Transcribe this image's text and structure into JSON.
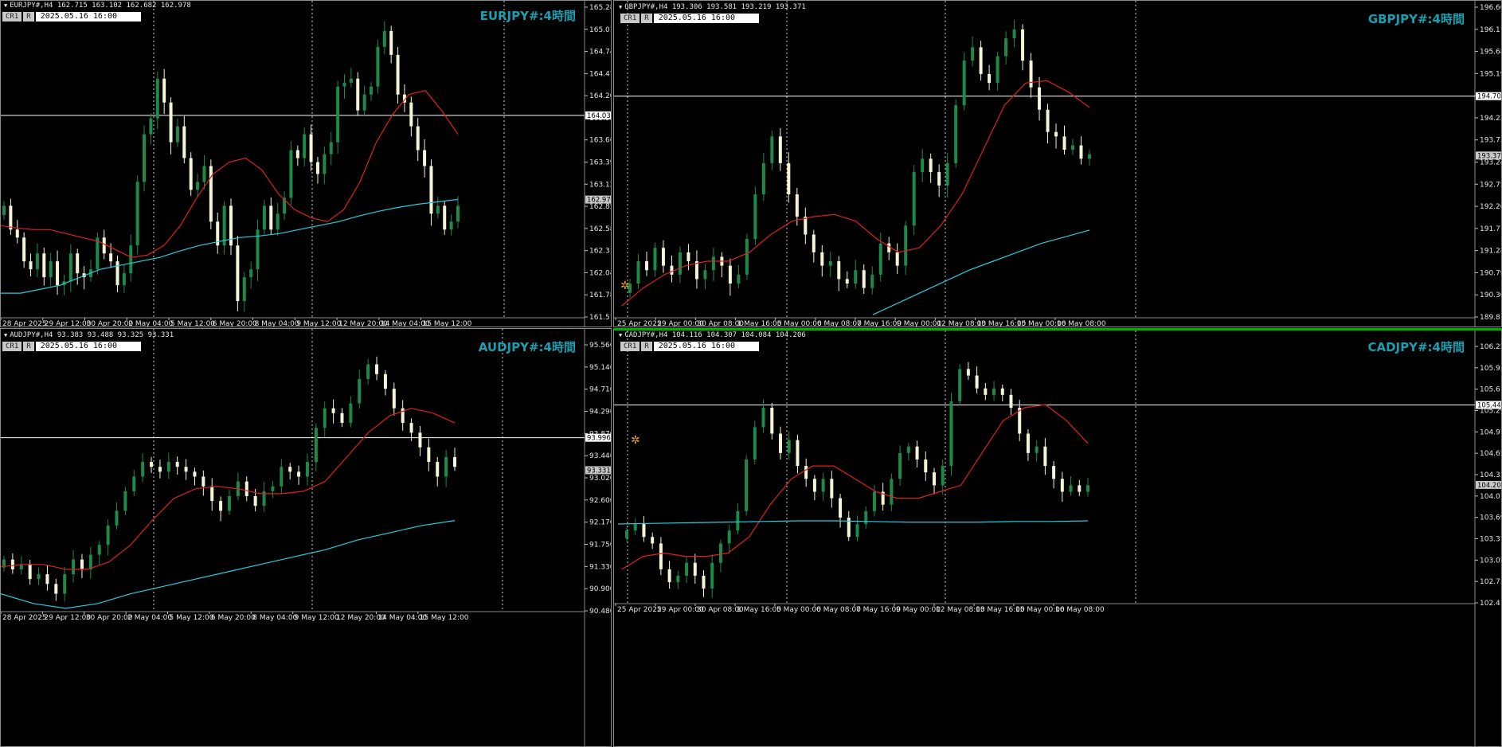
{
  "colors": {
    "bull": "#1e8a4a",
    "bear": "#f5f5d6",
    "ma_fast": "#e02020",
    "ma_slow": "#22cfe0",
    "title": "#1a9fb0",
    "hline": "#ffffff"
  },
  "chart_data": [
    {
      "type": "candlestick",
      "title": "EURJPY#:4時間",
      "header": "EURJPY#,H4  162.715 163.102 162.682 162.978",
      "chip_label": "CR1",
      "chip_r": "R",
      "datetime": "2025.05.16 16:00",
      "ylim": [
        161.5,
        165.4
      ],
      "yticks": [
        "165.280",
        "165.010",
        "164.740",
        "164.470",
        "164.200",
        "163.930",
        "163.665",
        "163.395",
        "163.125",
        "162.855",
        "162.585",
        "162.315",
        "162.045",
        "161.780",
        "161.510"
      ],
      "xticks": [
        "28 Apr 2025",
        "29 Apr 12:00",
        "30 Apr 20:00",
        "2 May 04:00",
        "5 May 12:00",
        "6 May 20:00",
        "8 May 04:00",
        "9 May 12:00",
        "12 May 20:00",
        "14 May 04:00",
        "15 May 12:00"
      ],
      "hline": {
        "value": 164.038,
        "label": "164.038"
      },
      "current": {
        "value": 162.978,
        "label": "162.978"
      },
      "closes": [
        162.9,
        162.6,
        162.5,
        162.2,
        162.1,
        162.3,
        162.0,
        162.2,
        161.9,
        161.95,
        162.3,
        162.05,
        162.0,
        162.1,
        162.5,
        162.3,
        162.2,
        161.9,
        162.05,
        162.4,
        163.2,
        163.8,
        164.0,
        164.5,
        164.2,
        163.7,
        163.9,
        163.5,
        163.1,
        163.2,
        163.4,
        162.7,
        162.4,
        162.9,
        162.4,
        161.7,
        162.0,
        162.1,
        162.6,
        162.9,
        162.6,
        162.8,
        163.0,
        163.6,
        163.5,
        163.8,
        163.45,
        163.3,
        163.55,
        163.7,
        164.4,
        164.45,
        164.5,
        164.1,
        164.3,
        164.4,
        164.9,
        165.1,
        164.8,
        164.3,
        164.2,
        163.9,
        163.6,
        163.4,
        162.8,
        162.9,
        162.6,
        162.7,
        162.9
      ],
      "ma_fast": [
        162.65,
        162.62,
        162.6,
        162.6,
        162.55,
        162.5,
        162.45,
        162.35,
        162.25,
        162.28,
        162.4,
        162.65,
        163.0,
        163.3,
        163.45,
        163.5,
        163.35,
        163.05,
        162.85,
        162.75,
        162.7,
        162.85,
        163.2,
        163.7,
        164.05,
        164.3,
        164.35,
        164.1,
        163.8
      ],
      "ma_slow": [
        161.8,
        161.8,
        161.85,
        161.9,
        162.0,
        162.1,
        162.15,
        162.2,
        162.25,
        162.33,
        162.4,
        162.45,
        162.5,
        162.52,
        162.55,
        162.6,
        162.65,
        162.7,
        162.77,
        162.83,
        162.88,
        162.92,
        162.95,
        162.98
      ]
    },
    {
      "type": "candlestick",
      "title": "GBPJPY#:4時間",
      "header": "GBPJPY#,H4  193.306 193.581 193.219 193.371",
      "chip_label": "CR1",
      "chip_r": "R",
      "datetime": "2025.05.16 16:00",
      "ylim": [
        189.75,
        196.7
      ],
      "yticks": [
        "196.660",
        "196.170",
        "195.680",
        "195.190",
        "194.704",
        "194.220",
        "193.730",
        "193.240",
        "192.750",
        "192.260",
        "191.770",
        "191.280",
        "190.790",
        "190.300",
        "189.810"
      ],
      "xticks": [
        "25 Apr 2025",
        "29 Apr 00:00",
        "30 Apr 08:00",
        "1 May 16:00",
        "5 May 00:00",
        "6 May 08:00",
        "7 May 16:00",
        "9 May 00:00",
        "12 May 08:00",
        "13 May 16:00",
        "15 May 00:00",
        "16 May 08:00"
      ],
      "hline": {
        "value": 194.704,
        "label": "194.704"
      },
      "current": {
        "value": 193.371,
        "label": "193.371"
      },
      "closes": [
        190.5,
        191.0,
        190.8,
        191.3,
        190.9,
        190.7,
        191.2,
        191.0,
        190.6,
        190.8,
        191.1,
        190.9,
        190.5,
        190.7,
        191.5,
        192.5,
        193.2,
        193.8,
        193.2,
        192.5,
        192.0,
        191.6,
        191.2,
        190.9,
        191.0,
        190.6,
        190.5,
        190.8,
        190.4,
        190.7,
        191.4,
        191.2,
        190.9,
        191.8,
        193.0,
        193.3,
        193.0,
        192.7,
        193.2,
        194.5,
        195.5,
        195.8,
        195.2,
        195.0,
        195.6,
        196.0,
        196.2,
        195.5,
        194.9,
        194.4,
        193.9,
        193.8,
        193.5,
        193.6,
        193.3,
        193.4
      ],
      "ma_fast": [
        190.0,
        190.4,
        190.7,
        190.9,
        191.0,
        191.0,
        191.2,
        191.6,
        191.9,
        192.0,
        192.05,
        191.9,
        191.5,
        191.2,
        191.3,
        191.8,
        192.5,
        193.5,
        194.5,
        195.0,
        195.05,
        194.8,
        194.45
      ],
      "ma_slow": [
        189.8,
        190.05,
        190.3,
        190.55,
        190.8,
        191.0,
        191.2,
        191.4,
        191.55,
        191.7
      ]
    },
    {
      "type": "candlestick",
      "title": "AUDJPY#:4時間",
      "header": "AUDJPY#,H4  93.383 93.488 93.325 93.331",
      "chip_label": "CR1",
      "chip_r": "R",
      "datetime": "2025.05.16 16:00",
      "ylim": [
        90.45,
        95.9
      ],
      "yticks": [
        "95.560",
        "95.140",
        "94.710",
        "94.290",
        "93.870",
        "93.440",
        "93.020",
        "92.600",
        "92.170",
        "91.750",
        "91.330",
        "90.900",
        "90.480"
      ],
      "xticks": [
        "28 Apr 2025",
        "29 Apr 12:00",
        "30 Apr 20:00",
        "2 May 04:00",
        "5 May 12:00",
        "6 May 20:00",
        "8 May 04:00",
        "9 May 12:00",
        "12 May 20:00",
        "14 May 04:00",
        "15 May 12:00"
      ],
      "hline": {
        "value": 93.996,
        "label": "93.996"
      },
      "current": {
        "value": 93.331,
        "label": "93.331"
      },
      "closes": [
        91.5,
        91.3,
        91.4,
        91.1,
        91.2,
        91.0,
        90.8,
        91.2,
        91.5,
        91.3,
        91.6,
        91.8,
        92.2,
        92.5,
        92.9,
        93.2,
        93.5,
        93.4,
        93.3,
        93.5,
        93.4,
        93.3,
        93.2,
        93.0,
        92.7,
        92.5,
        92.8,
        93.1,
        92.8,
        92.6,
        92.9,
        93.0,
        93.4,
        93.3,
        93.2,
        93.5,
        94.2,
        94.6,
        94.5,
        94.3,
        94.7,
        95.2,
        95.5,
        95.3,
        95.0,
        94.6,
        94.3,
        94.1,
        93.8,
        93.5,
        93.2,
        93.6,
        93.4
      ],
      "ma_fast": [
        91.35,
        91.4,
        91.4,
        91.3,
        91.3,
        91.45,
        91.8,
        92.3,
        92.75,
        92.95,
        93.0,
        92.95,
        92.85,
        92.85,
        92.9,
        93.1,
        93.6,
        94.1,
        94.45,
        94.6,
        94.5,
        94.3
      ],
      "ma_slow": [
        90.8,
        90.6,
        90.5,
        90.6,
        90.8,
        90.95,
        91.1,
        91.25,
        91.4,
        91.55,
        91.7,
        91.9,
        92.05,
        92.2,
        92.3
      ]
    },
    {
      "type": "candlestick",
      "title": "CADJPY#:4時間",
      "header": "CADJPY#,H4  104.116 104.307 104.084 104.206",
      "chip_label": "CR1",
      "chip_r": "R",
      "datetime": "2025.05.16 16:00",
      "ylim": [
        102.38,
        106.35
      ],
      "yticks": [
        "106.250",
        "105.930",
        "105.610",
        "105.290",
        "104.970",
        "104.650",
        "104.330",
        "104.010",
        "103.690",
        "103.370",
        "103.050",
        "102.730",
        "102.410"
      ],
      "xticks": [
        "25 Apr 2025",
        "29 Apr 00:00",
        "30 Apr 08:00",
        "1 May 16:00",
        "5 May 00:00",
        "6 May 08:00",
        "7 May 16:00",
        "9 May 00:00",
        "12 May 08:00",
        "13 May 16:00",
        "15 May 00:00",
        "16 May 08:00"
      ],
      "hline": {
        "value": 105.444,
        "label": "105.444"
      },
      "current": {
        "value": 104.206,
        "label": "104.206"
      },
      "closes": [
        103.5,
        103.6,
        103.4,
        103.3,
        102.9,
        102.7,
        102.8,
        103.0,
        102.8,
        102.6,
        103.0,
        103.3,
        103.5,
        103.8,
        104.6,
        105.1,
        105.4,
        105.0,
        104.7,
        104.9,
        104.5,
        104.3,
        104.1,
        104.3,
        104.0,
        103.7,
        103.4,
        103.6,
        103.8,
        104.1,
        103.9,
        104.3,
        104.7,
        104.8,
        104.6,
        104.4,
        104.2,
        104.5,
        105.5,
        106.0,
        105.9,
        105.7,
        105.6,
        105.7,
        105.6,
        105.4,
        105.0,
        104.7,
        104.8,
        104.5,
        104.3,
        104.1,
        104.2,
        104.1,
        104.2
      ],
      "ma_fast": [
        102.9,
        103.1,
        103.15,
        103.1,
        103.1,
        103.15,
        103.4,
        103.9,
        104.3,
        104.5,
        104.5,
        104.3,
        104.1,
        104.0,
        104.0,
        104.1,
        104.2,
        104.7,
        105.2,
        105.4,
        105.45,
        105.2,
        104.85
      ],
      "ma_slow": [
        103.6,
        103.61,
        103.62,
        103.63,
        103.64,
        103.65,
        103.65,
        103.64,
        103.63,
        103.63,
        103.63,
        103.64,
        103.64,
        103.65
      ]
    }
  ]
}
